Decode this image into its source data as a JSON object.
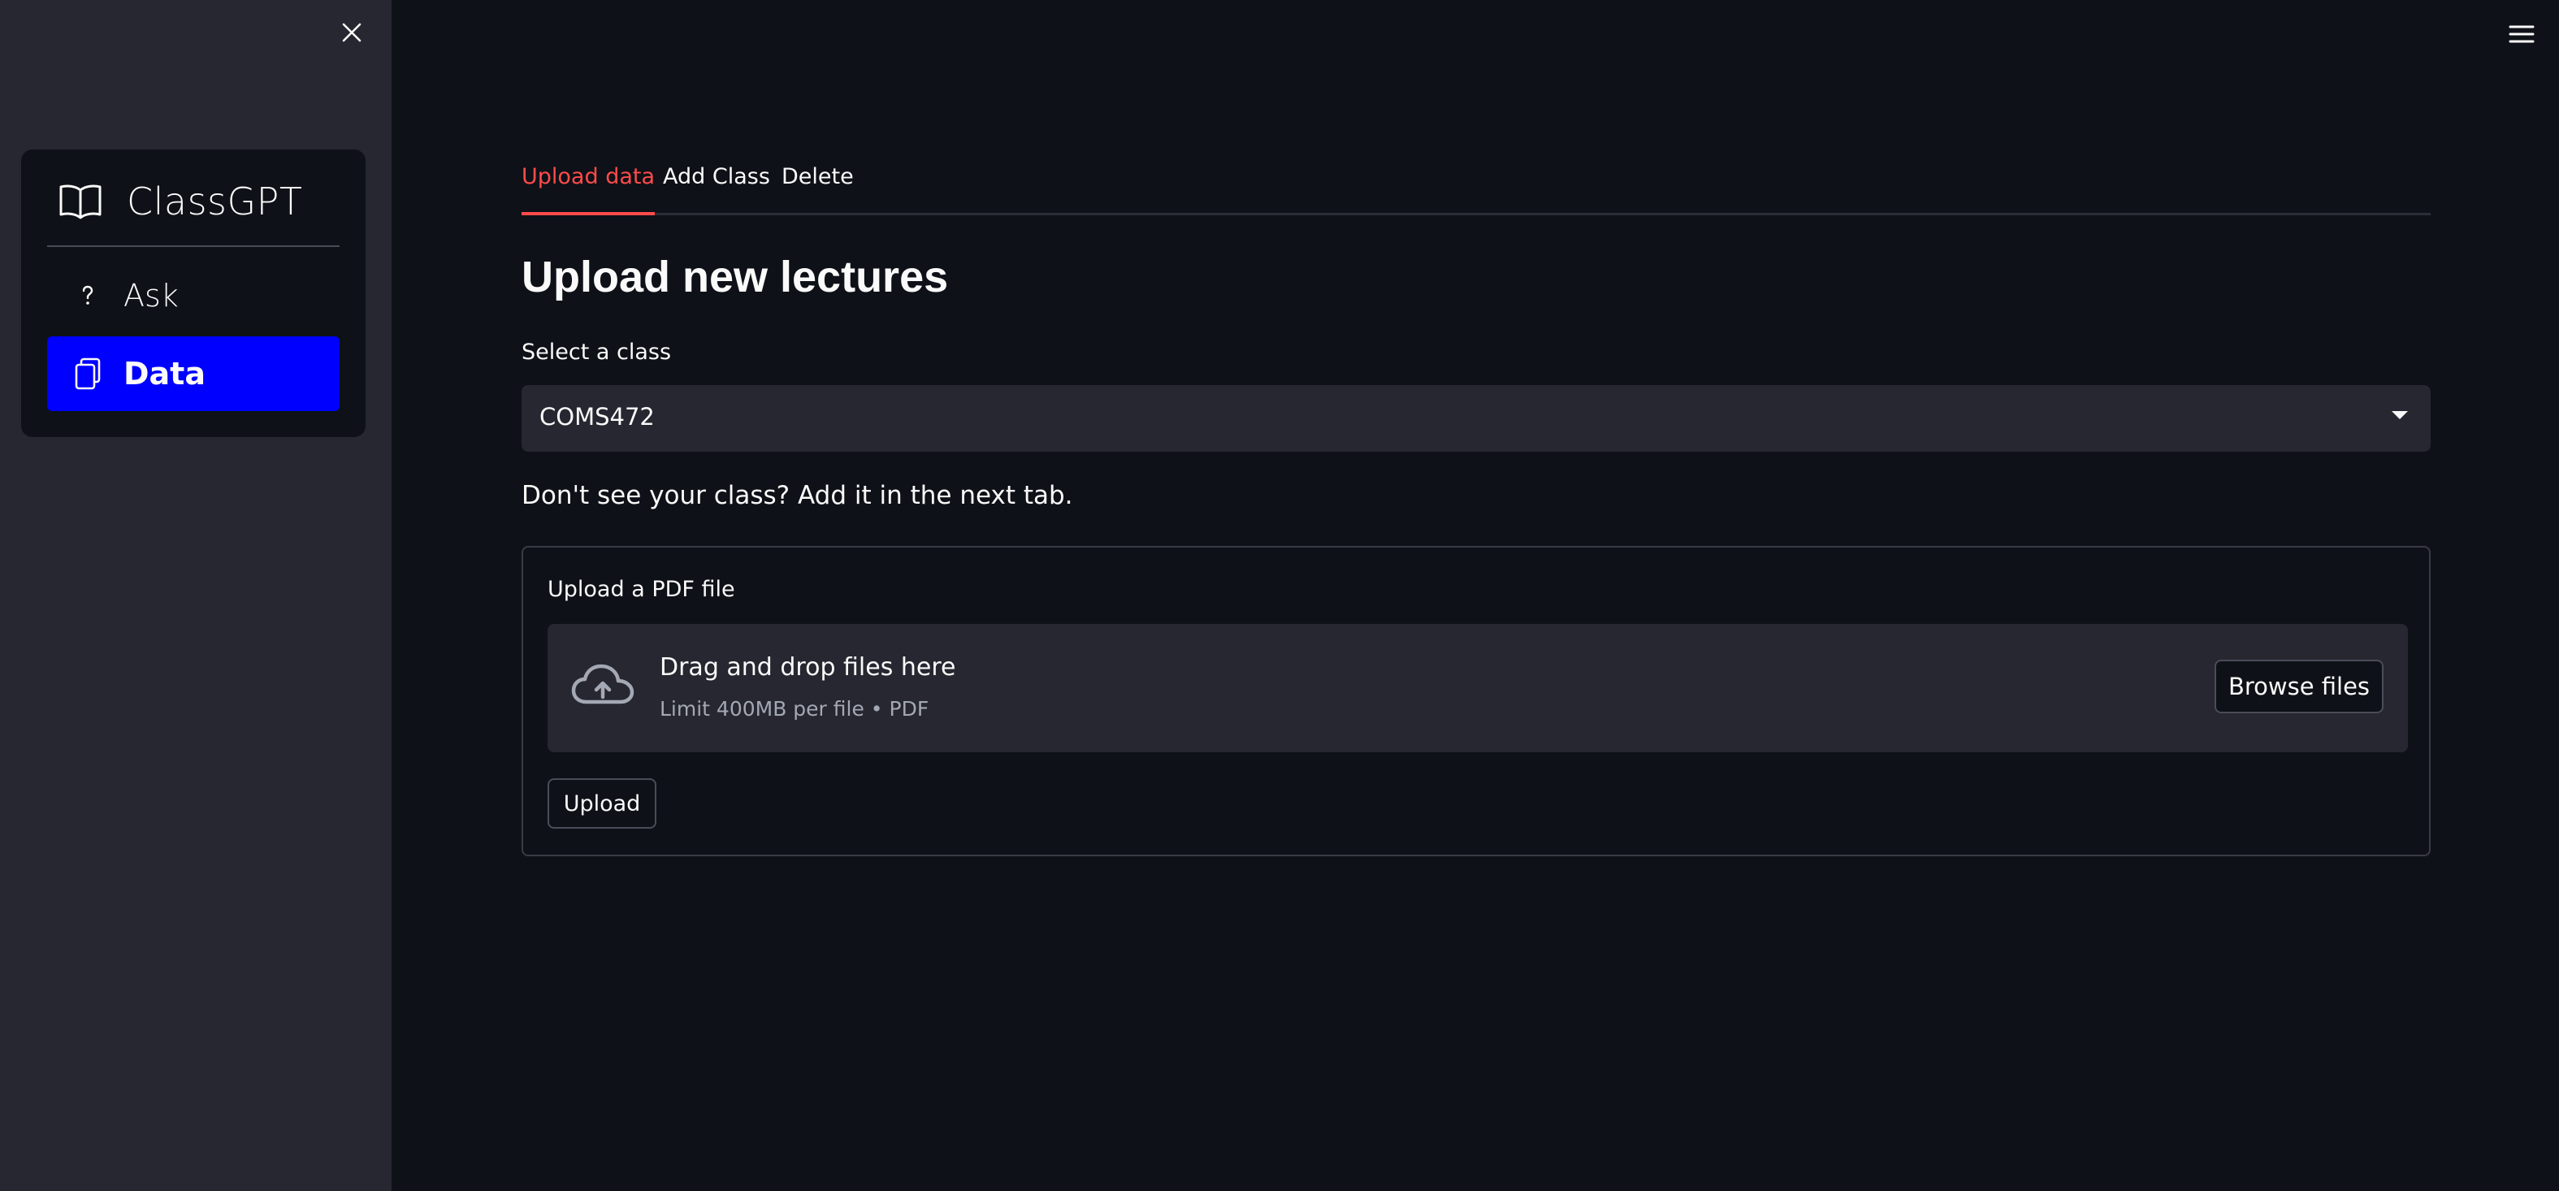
{
  "sidebar": {
    "close_icon": "close-icon",
    "app_icon": "book-open-icon",
    "app_title": "ClassGPT",
    "items": [
      {
        "label": "Ask",
        "icon": "question-mark-icon",
        "active": false
      },
      {
        "label": "Data",
        "icon": "files-icon",
        "active": true
      }
    ],
    "active_color": "#0000ff"
  },
  "header": {
    "menu_icon": "hamburger-menu-icon"
  },
  "main": {
    "tabs": [
      {
        "label": "Upload data",
        "active": true
      },
      {
        "label": "Add Class",
        "active": false
      },
      {
        "label": "Delete",
        "active": false
      }
    ],
    "active_tab_color": "#ff4b4b",
    "heading": "Upload new lectures",
    "class_select": {
      "label": "Select a class",
      "value": "COMS472"
    },
    "hint": "Don't see your class? Add it in the next tab.",
    "upload_form": {
      "label": "Upload a PDF file",
      "dropzone_title": "Drag and drop files here",
      "dropzone_subtitle": "Limit 400MB per file • PDF",
      "browse_label": "Browse files",
      "submit_label": "Upload"
    }
  }
}
